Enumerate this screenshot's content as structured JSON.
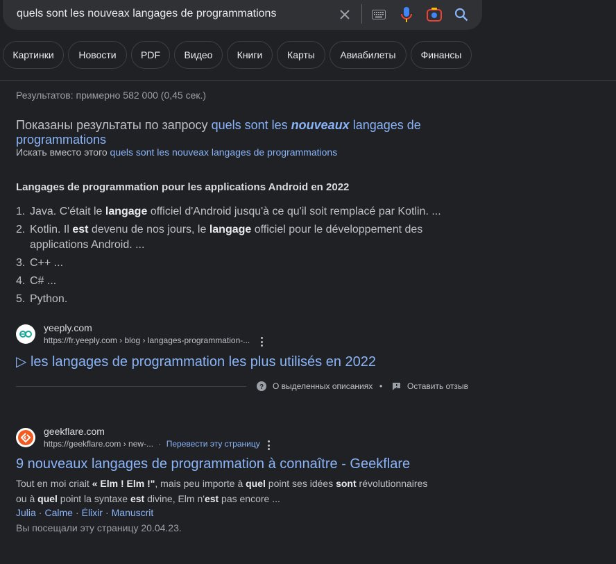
{
  "search": {
    "query": "quels sont les nouveax langages de programmations"
  },
  "chips": [
    "Картинки",
    "Новости",
    "PDF",
    "Видео",
    "Книги",
    "Карты",
    "Авиабилеты",
    "Финансы"
  ],
  "stats": "Результатов: примерно 582 000 (0,45 сек.)",
  "spelling": {
    "prefix": "Показаны результаты по запросу",
    "corrected_part1": "quels sont les",
    "corrected_bold": "nouveaux",
    "corrected_part2": "langages de programmations",
    "instead_label": "Искать вместо этого",
    "original": "quels sont les nouveax langages de programmations"
  },
  "featured": {
    "title": "Langages de programmation pour les applications Android en 2022",
    "items": [
      {
        "num": "1.",
        "a": "Java. C'était le ",
        "b": "langage",
        "c": " officiel d'Android jusqu'à ce qu'il soit remplacé par Kotlin. ..."
      },
      {
        "num": "2.",
        "a": "Kotlin. Il ",
        "b": "est",
        "c": " devenu de nos jours, le ",
        "d": "langage",
        "e": " officiel pour le développement des applications Android. ..."
      },
      {
        "num": "3.",
        "a": "C++ ..."
      },
      {
        "num": "4.",
        "a": "C# ..."
      },
      {
        "num": "5.",
        "a": "Python."
      }
    ],
    "site_name": "yeeply.com",
    "site_url": "https://fr.yeeply.com › blog › langages-programmation-...",
    "link_title": "▷ les langages de programmation les plus utilisés en 2022",
    "about_label": "О выделенных описаниях",
    "feedback_label": "Оставить отзыв",
    "bullet": "•"
  },
  "result2": {
    "site_name": "geekflare.com",
    "site_url": "https://geekflare.com › new-...",
    "dot": "·",
    "translate": "Перевести эту страницу",
    "title": "9 nouveaux langages de programmation à connaître - Geekflare",
    "desc_line1_a": "Tout en moi criait ",
    "desc_line1_b": "« Elm ! Elm !\"",
    "desc_line1_c": ", mais peu importe à ",
    "desc_line1_d": "quel",
    "desc_line1_e": " point ses idées ",
    "desc_line1_f": "sont",
    "desc_line1_g": " révolutionnaires",
    "desc_line2_a": "ou à ",
    "desc_line2_b": "quel",
    "desc_line2_c": " point la syntaxe ",
    "desc_line2_d": "est",
    "desc_line2_e": " divine, Elm n'",
    "desc_line2_f": "est",
    "desc_line2_g": " pas encore ...",
    "sublinks": [
      "Julia",
      "Calme",
      "Élixir",
      "Manuscrit"
    ],
    "visited": "Вы посещали эту страницу 20.04.23."
  },
  "colors": {
    "background": "#202124",
    "link": "#8ab4f8",
    "text": "#bdc1c6"
  },
  "icons": [
    "close-icon",
    "keyboard-icon",
    "microphone-icon",
    "camera-icon",
    "search-icon",
    "help-icon",
    "feedback-icon",
    "more-vert-icon"
  ]
}
